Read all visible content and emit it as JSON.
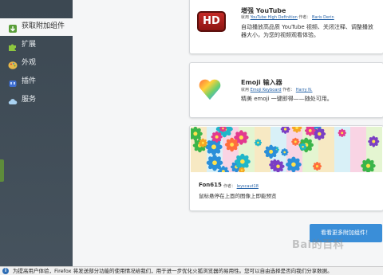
{
  "sidebar": {
    "items": [
      {
        "label": "获取附加组件",
        "icon": "puzzle-download-icon"
      },
      {
        "label": "扩展",
        "icon": "puzzle-icon"
      },
      {
        "label": "外观",
        "icon": "palette-icon"
      },
      {
        "label": "插件",
        "icon": "plugin-icon"
      },
      {
        "label": "服务",
        "icon": "cloud-icon"
      }
    ]
  },
  "cards": [
    {
      "name": "增强 YouTube",
      "by_prefix": "就用",
      "by_author_label": "作者：",
      "source": "YouTube High Definition",
      "author": "Baris Derin",
      "description": "自动播放高品质 YouTube 视频、关闭注释、调整播放器大小，为您的视频观看体验。",
      "icon": "hd-icon",
      "icon_text": "HD"
    },
    {
      "name": "Emoji 输入器",
      "by_prefix": "就用",
      "by_author_label": "作者：",
      "source": "Emoji Keyboard",
      "author": "Harry N.",
      "description": "精美 emoji 一键即得——随处可用。",
      "icon": "heart-icon"
    },
    {
      "name": "Fon615",
      "by_prefix": "作者：",
      "author": "leyscaut18",
      "description": "鼠标悬停在上面的图像上即能预览",
      "icon": "floral-pattern-image"
    }
  ],
  "get_more_label": "看看更多附加组件！",
  "notification": {
    "icon": "info-icon",
    "text": "为提高用户体验，Firefox 将发送部分功能的使用情况给我们，用于进一步优化火狐浏览器的易用性。您可以自由选择是否向我们分享数据。"
  },
  "watermark": "Bai的百科"
}
